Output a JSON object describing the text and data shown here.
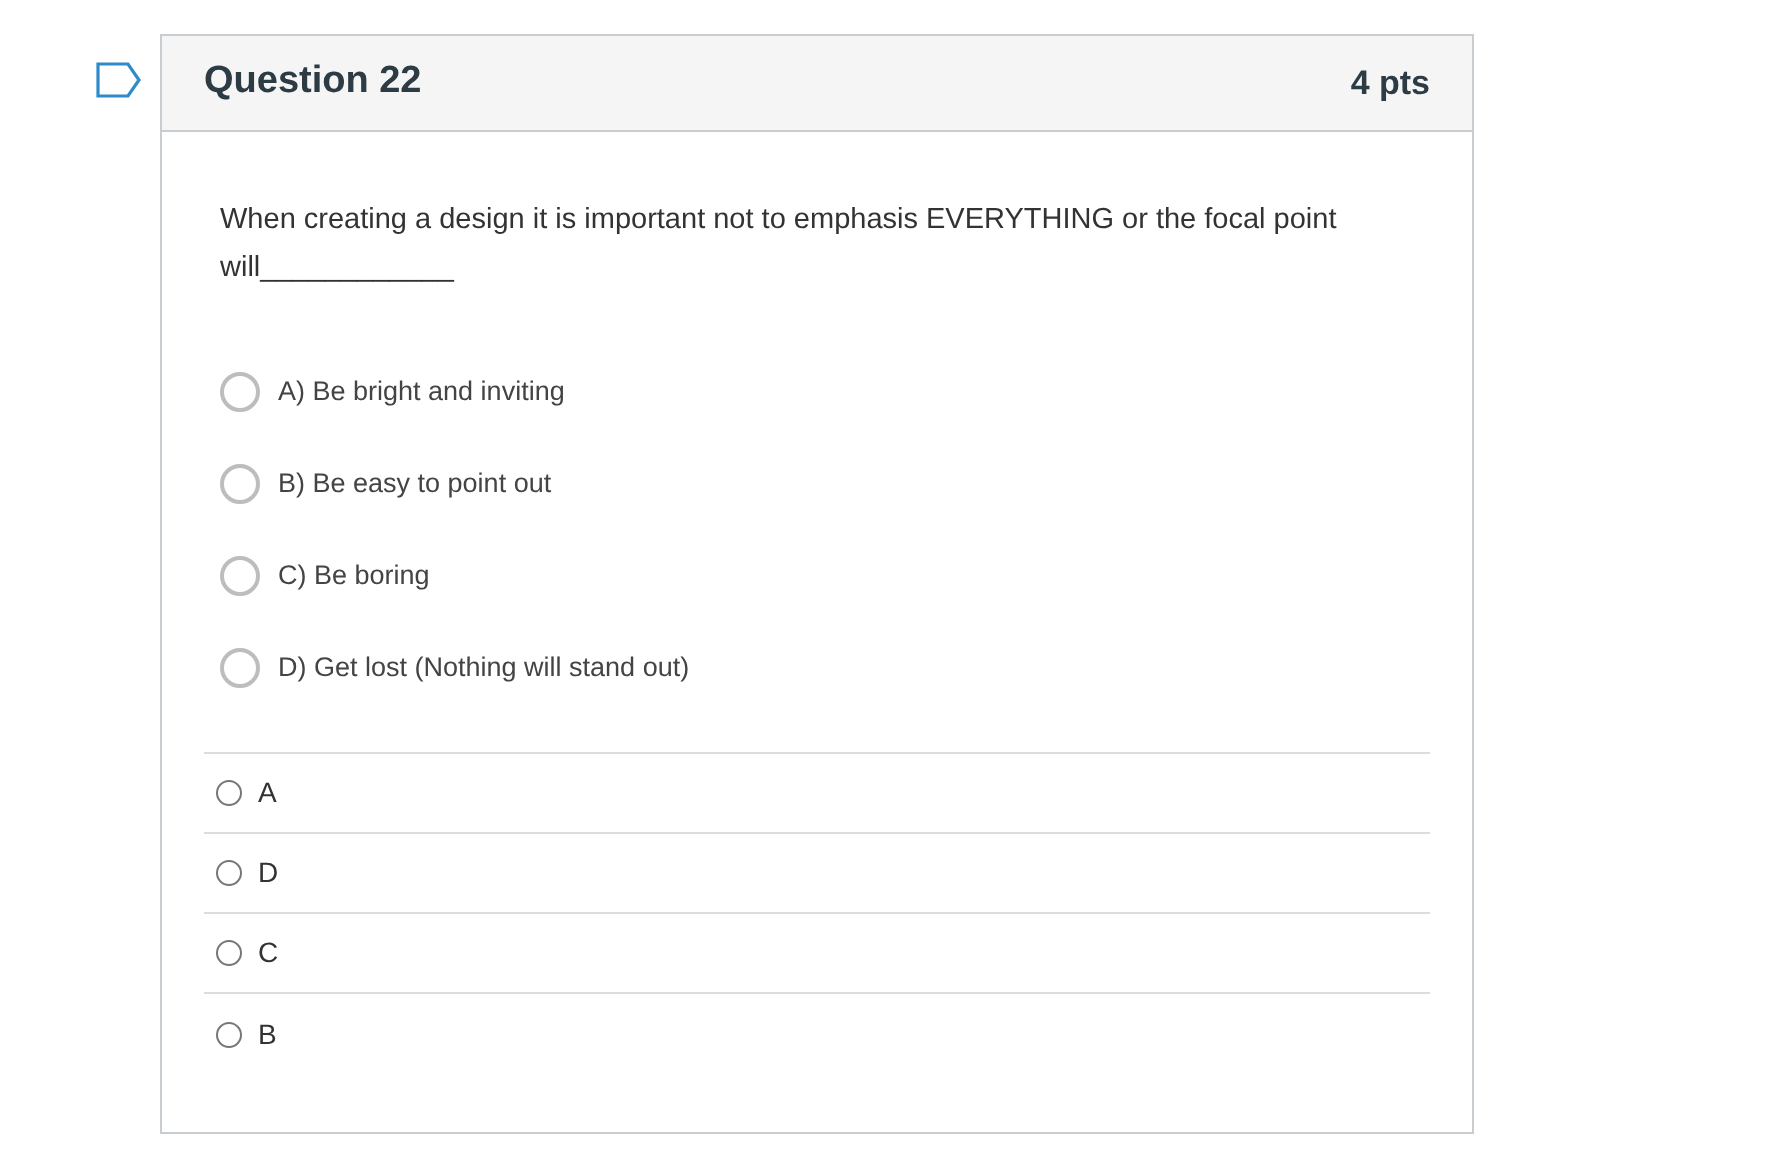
{
  "question": {
    "title": "Question 22",
    "points": "4 pts",
    "flagged": false,
    "text": "When creating a design it is important not to emphasis EVERYTHING or the focal point will____________",
    "choices": [
      {
        "label": "A) Be bright and inviting",
        "selected": false
      },
      {
        "label": "B) Be easy to point out",
        "selected": false
      },
      {
        "label": "C) Be boring",
        "selected": false
      },
      {
        "label": "D) Get lost (Nothing will stand out)",
        "selected": false
      }
    ],
    "answers": [
      {
        "label": "A",
        "selected": false
      },
      {
        "label": "D",
        "selected": false
      },
      {
        "label": "C",
        "selected": false
      },
      {
        "label": "B",
        "selected": false
      }
    ]
  }
}
